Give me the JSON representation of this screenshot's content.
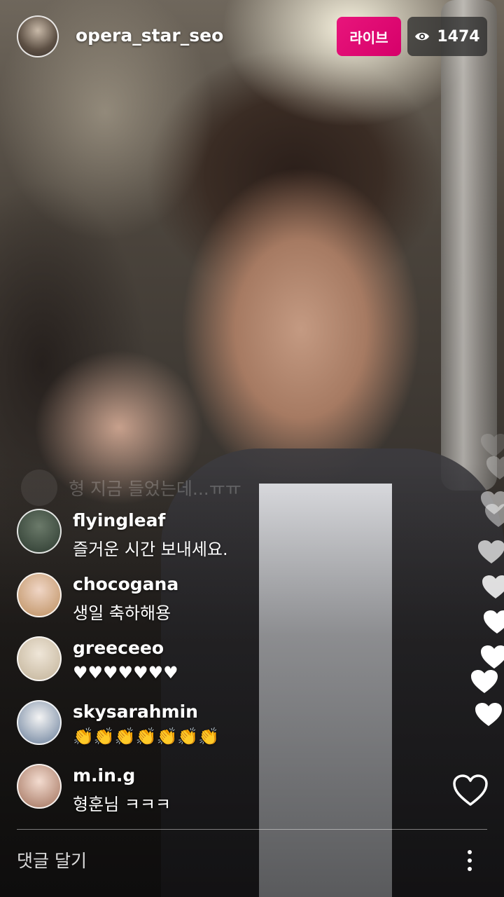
{
  "header": {
    "host_username": "opera_star_seo",
    "live_label": "라이브",
    "viewer_count": "1474",
    "viewer_icon": "eye-icon"
  },
  "faded_comment": {
    "text": "형 지금 들었는데...ㅠㅠ"
  },
  "comments": [
    {
      "username": "flyingleaf",
      "text": "즐거운 시간 보내세요.",
      "avatar_colors": [
        "#6b7a6a",
        "#3c4a3e"
      ]
    },
    {
      "username": "chocogana",
      "text": "생일 축하해용",
      "avatar_colors": [
        "#f0d6c6",
        "#c9a078"
      ]
    },
    {
      "username": "greeceeo",
      "text": "♥♥♥♥♥♥♥",
      "avatar_colors": [
        "#efe6d8",
        "#cdbfa8"
      ]
    },
    {
      "username": "skysarahmin",
      "text": "👏👏👏👏👏👏👏",
      "avatar_colors": [
        "#f4f4f4",
        "#8b9bb0"
      ]
    },
    {
      "username": "m.in.g",
      "text": "형훈님 ㅋㅋㅋ",
      "avatar_colors": [
        "#f3dcd0",
        "#b58b78"
      ]
    }
  ],
  "actions": {
    "like_icon": "heart-outline-icon",
    "more_icon": "more-vertical-icon"
  },
  "comment_box": {
    "placeholder": "댓글 달기"
  },
  "colors": {
    "live_badge": "#e0137a",
    "viewer_badge_bg": "rgba(40,40,40,0.75)",
    "text": "#ffffff"
  }
}
